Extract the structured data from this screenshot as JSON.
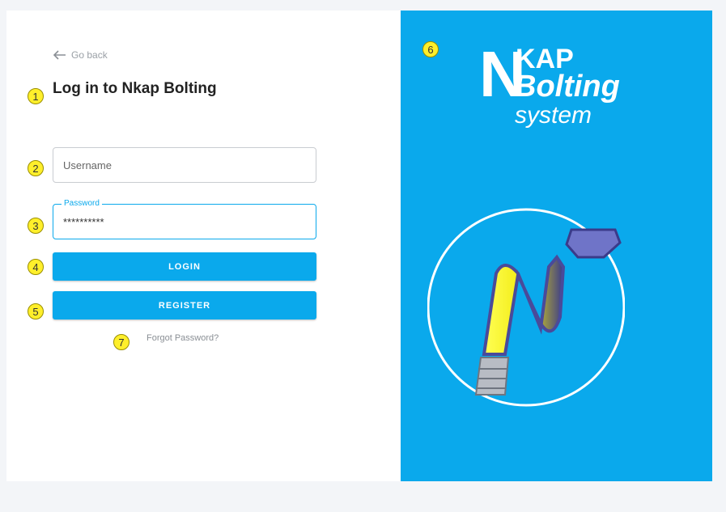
{
  "login": {
    "go_back": "Go back",
    "title": "Log in to Nkap Bolting",
    "username_placeholder": "Username",
    "password_label": "Password",
    "password_value": "**********",
    "login_label": "LOGIN",
    "register_label": "REGISTER",
    "forgot_label": "Forgot Password?"
  },
  "brand": {
    "letter": "N",
    "line1": "KAP",
    "line2": "Bolting",
    "line3": "system",
    "accent_color": "#0aa9ec"
  },
  "annotations": [
    "1",
    "2",
    "3",
    "4",
    "5",
    "6",
    "7"
  ]
}
